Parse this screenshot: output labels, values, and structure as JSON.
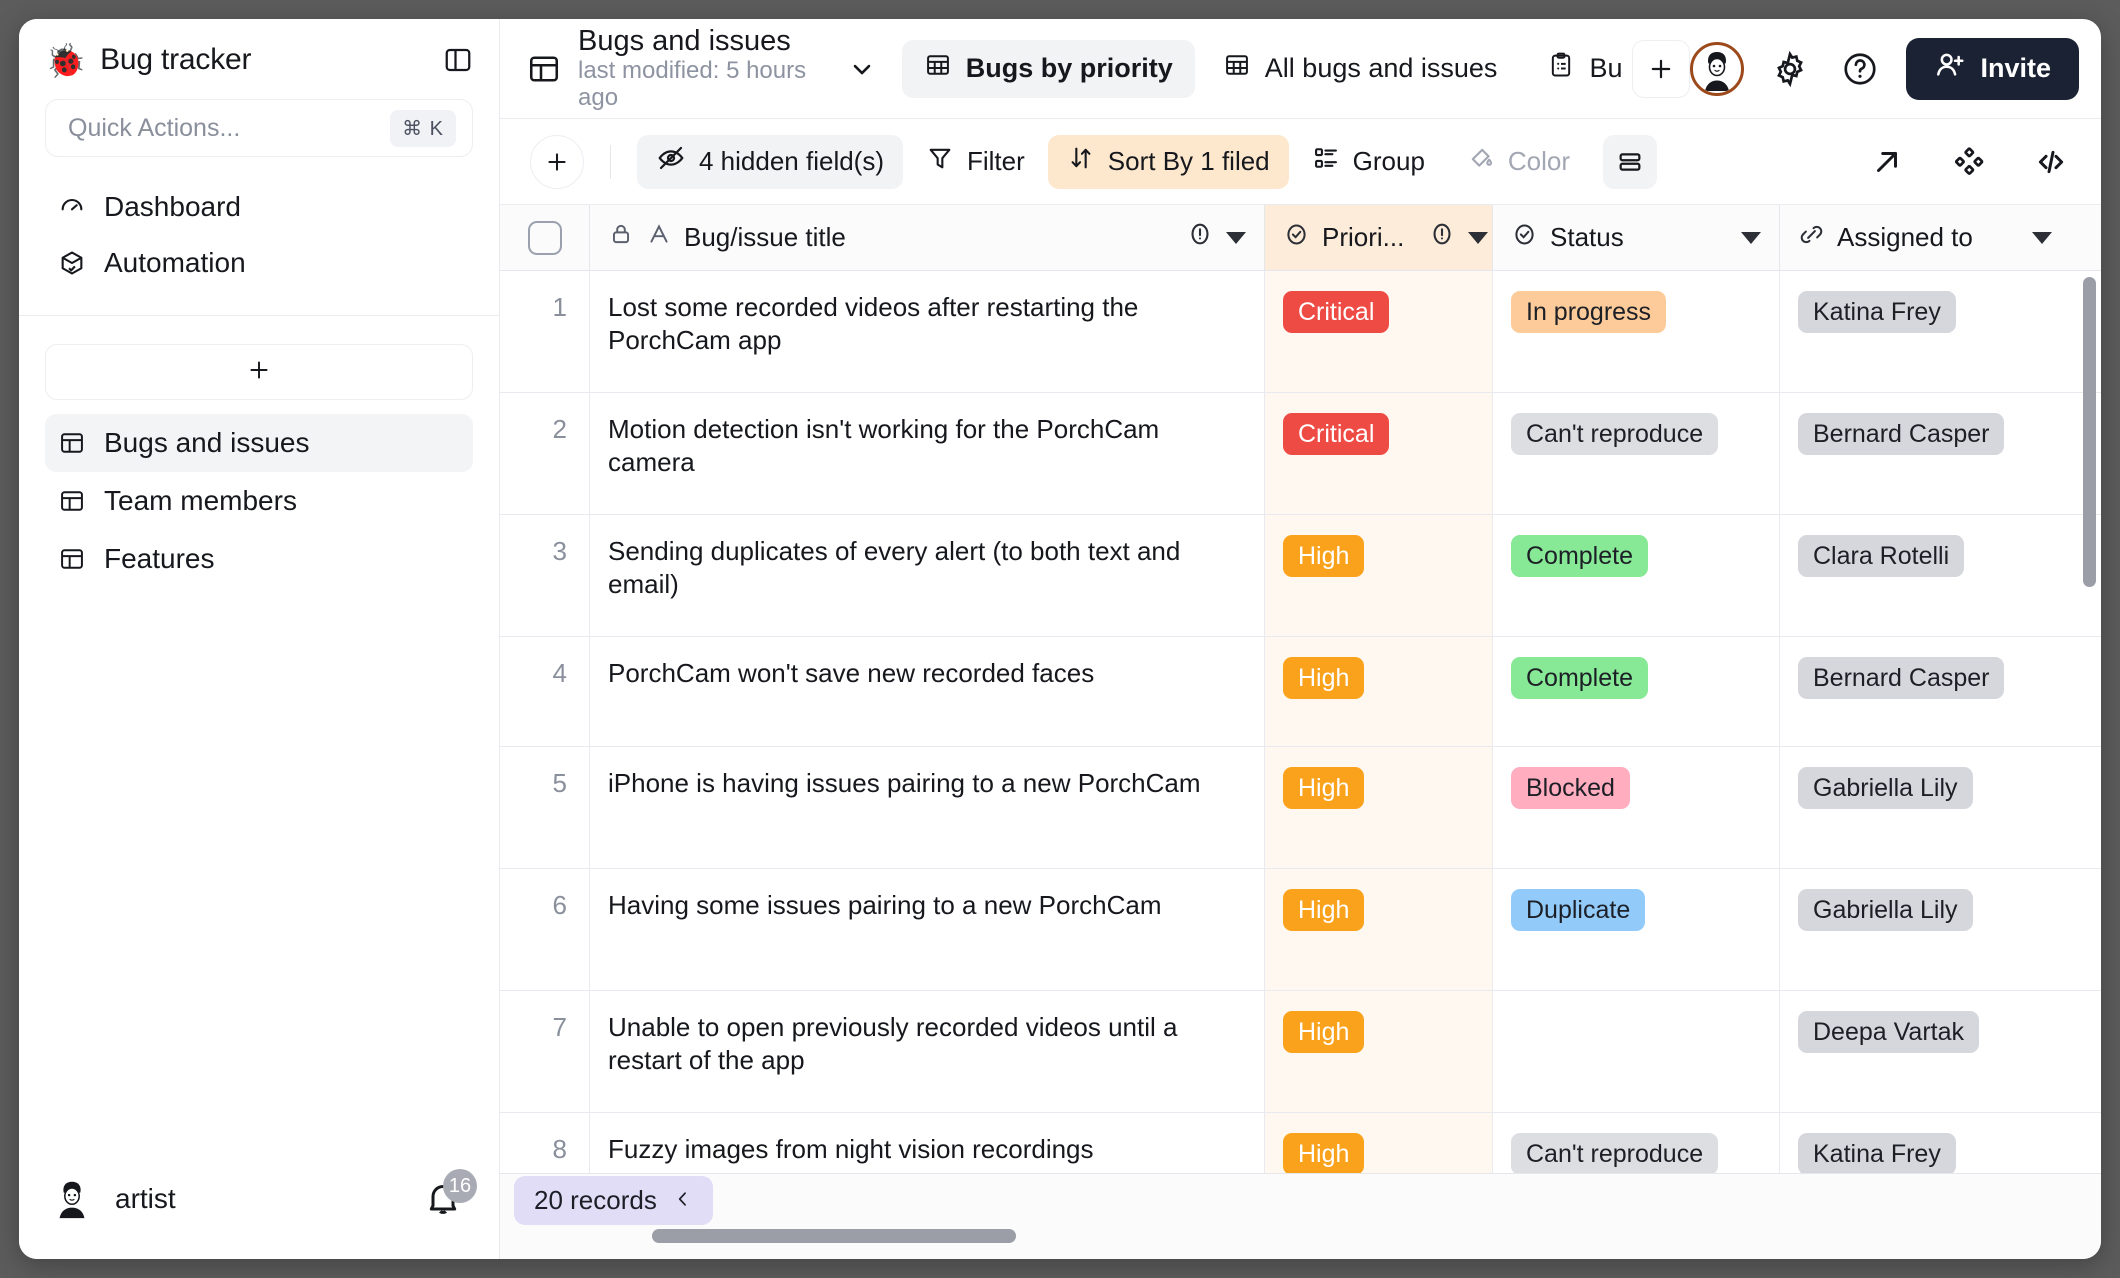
{
  "sidebar": {
    "logo_icon": "ladybug-icon",
    "title": "Bug tracker",
    "panel_toggle_icon": "sidebar-panel-icon",
    "quick_actions": {
      "placeholder": "Quick Actions...",
      "shortcut": "⌘ K"
    },
    "nav": [
      {
        "label": "Dashboard",
        "icon": "gauge-icon"
      },
      {
        "label": "Automation",
        "icon": "package-check-icon"
      }
    ],
    "add_table_icon": "plus-icon",
    "tables": [
      {
        "label": "Bugs and issues",
        "icon": "table-icon",
        "active": true
      },
      {
        "label": "Team members",
        "icon": "table-icon",
        "active": false
      },
      {
        "label": "Features",
        "icon": "table-icon",
        "active": false
      }
    ],
    "footer": {
      "user": "artist",
      "avatar_icon": "user-avatar",
      "bell_icon": "bell-icon",
      "notification_count": "16"
    }
  },
  "topbar": {
    "doc_icon": "table-icon",
    "doc_title": "Bugs and issues",
    "doc_subtitle": "last modified: 5 hours ago",
    "dropdown_icon": "chevron-down-icon",
    "views": [
      {
        "label": "Bugs by priority",
        "icon": "grid-icon",
        "active": true
      },
      {
        "label": "All bugs and issues",
        "icon": "grid-icon",
        "active": false
      },
      {
        "label": "Bu",
        "icon": "clipboard-icon",
        "active": false
      }
    ],
    "add_view_icon": "plus-icon",
    "avatar_icon": "user-avatar",
    "settings_icon": "gear-icon",
    "help_icon": "question-circle-icon",
    "invite_label": "Invite",
    "invite_icon": "user-plus-icon",
    "invite_color": "#1b2233"
  },
  "toolbar": {
    "add_icon": "plus-icon",
    "hidden_fields": {
      "label": "4 hidden field(s)",
      "icon": "eye-off-icon"
    },
    "filter": {
      "label": "Filter",
      "icon": "funnel-icon"
    },
    "sort": {
      "label": "Sort By 1 filed",
      "icon": "sort-arrows-icon",
      "color": "#fde8cd"
    },
    "group": {
      "label": "Group",
      "icon": "group-list-icon"
    },
    "color": {
      "label": "Color",
      "icon": "paint-drop-icon"
    },
    "row_height_icon": "row-height-icon",
    "expand_icon": "arrow-up-right-icon",
    "api_icon": "diamond-cluster-icon",
    "code_icon": "code-brackets-icon"
  },
  "grid": {
    "columns": [
      {
        "key": "check",
        "label": "",
        "icon": "checkbox-icon"
      },
      {
        "key": "title",
        "label": "Bug/issue title",
        "icon": "lock-icon",
        "type_icon": "text-A-icon",
        "alert_icon": "alert-circle-icon",
        "menu_icon": "caret-down-icon"
      },
      {
        "key": "prio",
        "label": "Priori...",
        "icon": "select-circle-icon",
        "alert_icon": "alert-circle-icon",
        "menu_icon": "caret-down-icon"
      },
      {
        "key": "status",
        "label": "Status",
        "icon": "select-circle-icon",
        "menu_icon": "caret-down-icon"
      },
      {
        "key": "assign",
        "label": "Assigned to",
        "icon": "link-icon",
        "menu_icon": "caret-down-icon"
      }
    ],
    "rows": [
      {
        "n": "1",
        "title": "Lost some recorded videos after restarting the PorchCam app",
        "priority": "Critical",
        "priority_class": "critical",
        "status": "In progress",
        "status_class": "inprogress",
        "assignee": "Katina Frey"
      },
      {
        "n": "2",
        "title": "Motion detection isn't working for the PorchCam camera",
        "priority": "Critical",
        "priority_class": "critical",
        "status": "Can't reproduce",
        "status_class": "cantrepro",
        "assignee": "Bernard Casper"
      },
      {
        "n": "3",
        "title": "Sending duplicates of every alert (to both text and email)",
        "priority": "High",
        "priority_class": "high",
        "status": "Complete",
        "status_class": "complete",
        "assignee": "Clara Rotelli"
      },
      {
        "n": "4",
        "title": "PorchCam won't save new recorded faces",
        "priority": "High",
        "priority_class": "high",
        "status": "Complete",
        "status_class": "complete",
        "assignee": "Bernard Casper"
      },
      {
        "n": "5",
        "title": "iPhone is having issues pairing to a new PorchCam",
        "priority": "High",
        "priority_class": "high",
        "status": "Blocked",
        "status_class": "blocked",
        "assignee": "Gabriella Lily"
      },
      {
        "n": "6",
        "title": "Having some issues pairing to a new PorchCam",
        "priority": "High",
        "priority_class": "high",
        "status": "Duplicate",
        "status_class": "duplicate",
        "assignee": "Gabriella Lily"
      },
      {
        "n": "7",
        "title": "Unable to open previously recorded videos until a restart of the app",
        "priority": "High",
        "priority_class": "high",
        "status": "",
        "status_class": "",
        "assignee": "Deepa Vartak"
      },
      {
        "n": "8",
        "title": "Fuzzy images from night vision recordings",
        "priority": "High",
        "priority_class": "high",
        "status": "Can't reproduce",
        "status_class": "cantrepro",
        "assignee": "Katina Frey"
      }
    ]
  },
  "footer": {
    "records_label": "20 records",
    "collapse_icon": "chevron-left-icon"
  }
}
